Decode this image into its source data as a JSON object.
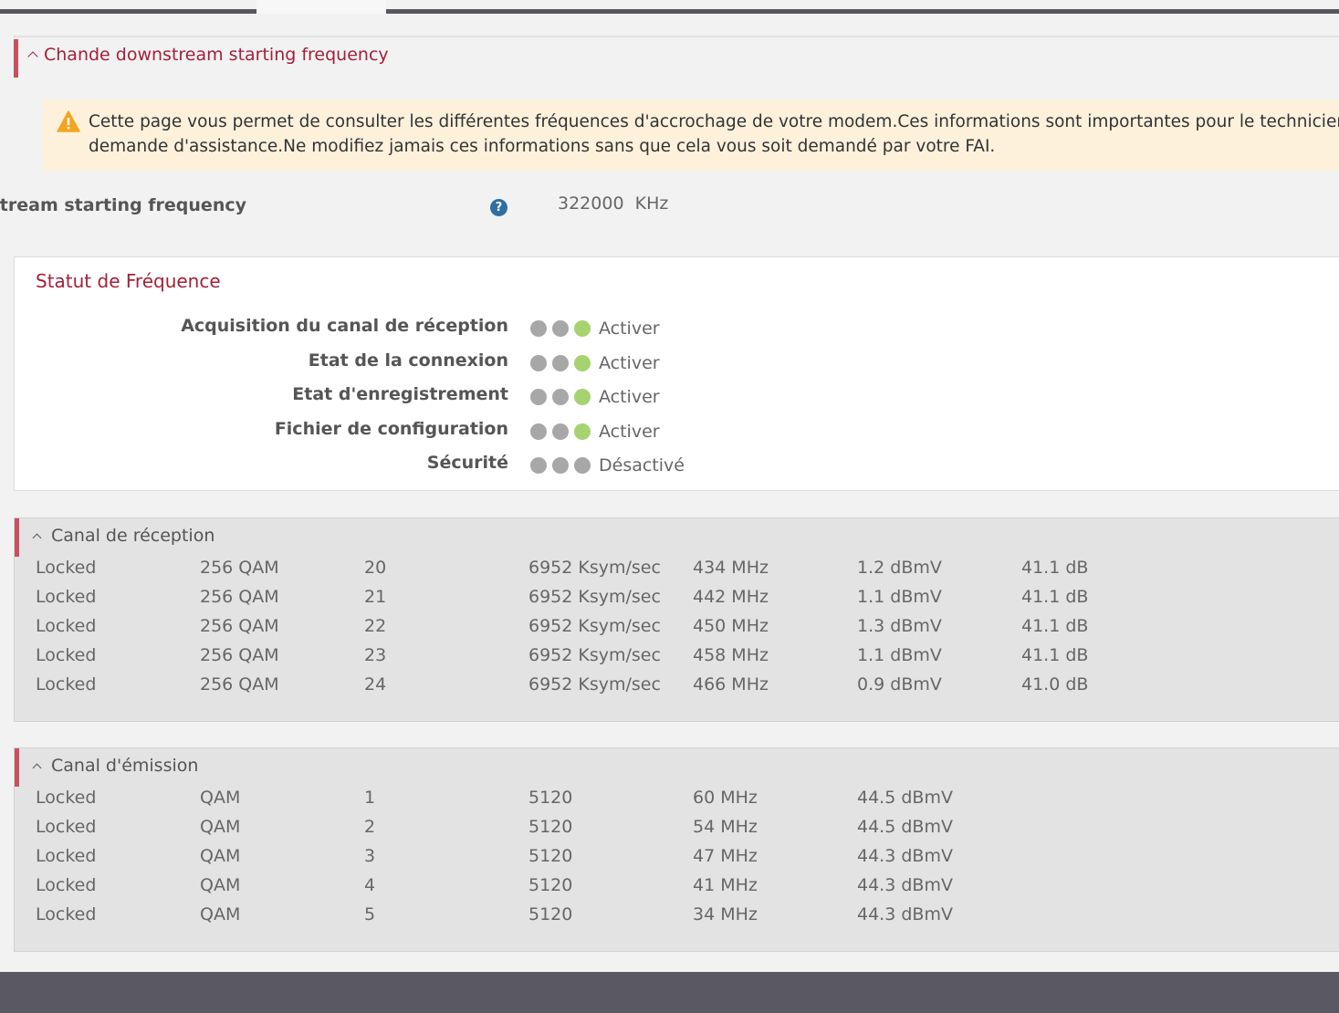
{
  "main_section": {
    "title": "Chande downstream starting frequency",
    "warning_line1": "Cette page vous permet de consulter les différentes fréquences d'accrochage de votre modem.Ces informations sont importantes pour le technicien da",
    "warning_line2": "demande d'assistance.Ne modifiez jamais ces informations sans que cela vous soit demandé par votre FAI.",
    "field_label": "Downstream starting frequency",
    "help_symbol": "?",
    "field_value": "322000  KHz"
  },
  "status": {
    "title": "Statut de Fréquence",
    "rows": [
      {
        "label": "Acquisition du canal de réception",
        "value": "Activer",
        "dots": [
          "gray",
          "gray",
          "green"
        ]
      },
      {
        "label": "Etat de la connexion",
        "value": "Activer",
        "dots": [
          "gray",
          "gray",
          "green"
        ]
      },
      {
        "label": "Etat d'enregistrement",
        "value": "Activer",
        "dots": [
          "gray",
          "gray",
          "green"
        ]
      },
      {
        "label": "Fichier de configuration",
        "value": "Activer",
        "dots": [
          "gray",
          "gray",
          "green"
        ]
      },
      {
        "label": "Sécurité",
        "value": "Désactivé",
        "dots": [
          "gray",
          "gray",
          "gray"
        ]
      }
    ]
  },
  "downstream": {
    "title": "Canal de réception",
    "rows": [
      [
        "Locked",
        "256 QAM",
        "20",
        "6952 Ksym/sec",
        "434 MHz",
        "1.2 dBmV",
        "41.1 dB"
      ],
      [
        "Locked",
        "256 QAM",
        "21",
        "6952 Ksym/sec",
        "442 MHz",
        "1.1 dBmV",
        "41.1 dB"
      ],
      [
        "Locked",
        "256 QAM",
        "22",
        "6952 Ksym/sec",
        "450 MHz",
        "1.3 dBmV",
        "41.1 dB"
      ],
      [
        "Locked",
        "256 QAM",
        "23",
        "6952 Ksym/sec",
        "458 MHz",
        "1.1 dBmV",
        "41.1 dB"
      ],
      [
        "Locked",
        "256 QAM",
        "24",
        "6952 Ksym/sec",
        "466 MHz",
        "0.9 dBmV",
        "41.0 dB"
      ]
    ]
  },
  "upstream": {
    "title": "Canal d'émission",
    "rows": [
      [
        "Locked",
        "QAM",
        "1",
        "5120",
        "60 MHz",
        "44.5 dBmV"
      ],
      [
        "Locked",
        "QAM",
        "2",
        "5120",
        "54 MHz",
        "44.5 dBmV"
      ],
      [
        "Locked",
        "QAM",
        "3",
        "5120",
        "47 MHz",
        "44.3 dBmV"
      ],
      [
        "Locked",
        "QAM",
        "4",
        "5120",
        "41 MHz",
        "44.3 dBmV"
      ],
      [
        "Locked",
        "QAM",
        "5",
        "5120",
        "34 MHz",
        "44.3 dBmV"
      ]
    ]
  },
  "colors": {
    "accent": "#a2213a",
    "accent_bar": "#c8505f",
    "dot_active": "#a6d270",
    "dot_inactive": "#a7a7a7",
    "warning_bg": "#fdf1dc",
    "help_icon": "#2d6ea3",
    "footer": "#5a5963"
  }
}
